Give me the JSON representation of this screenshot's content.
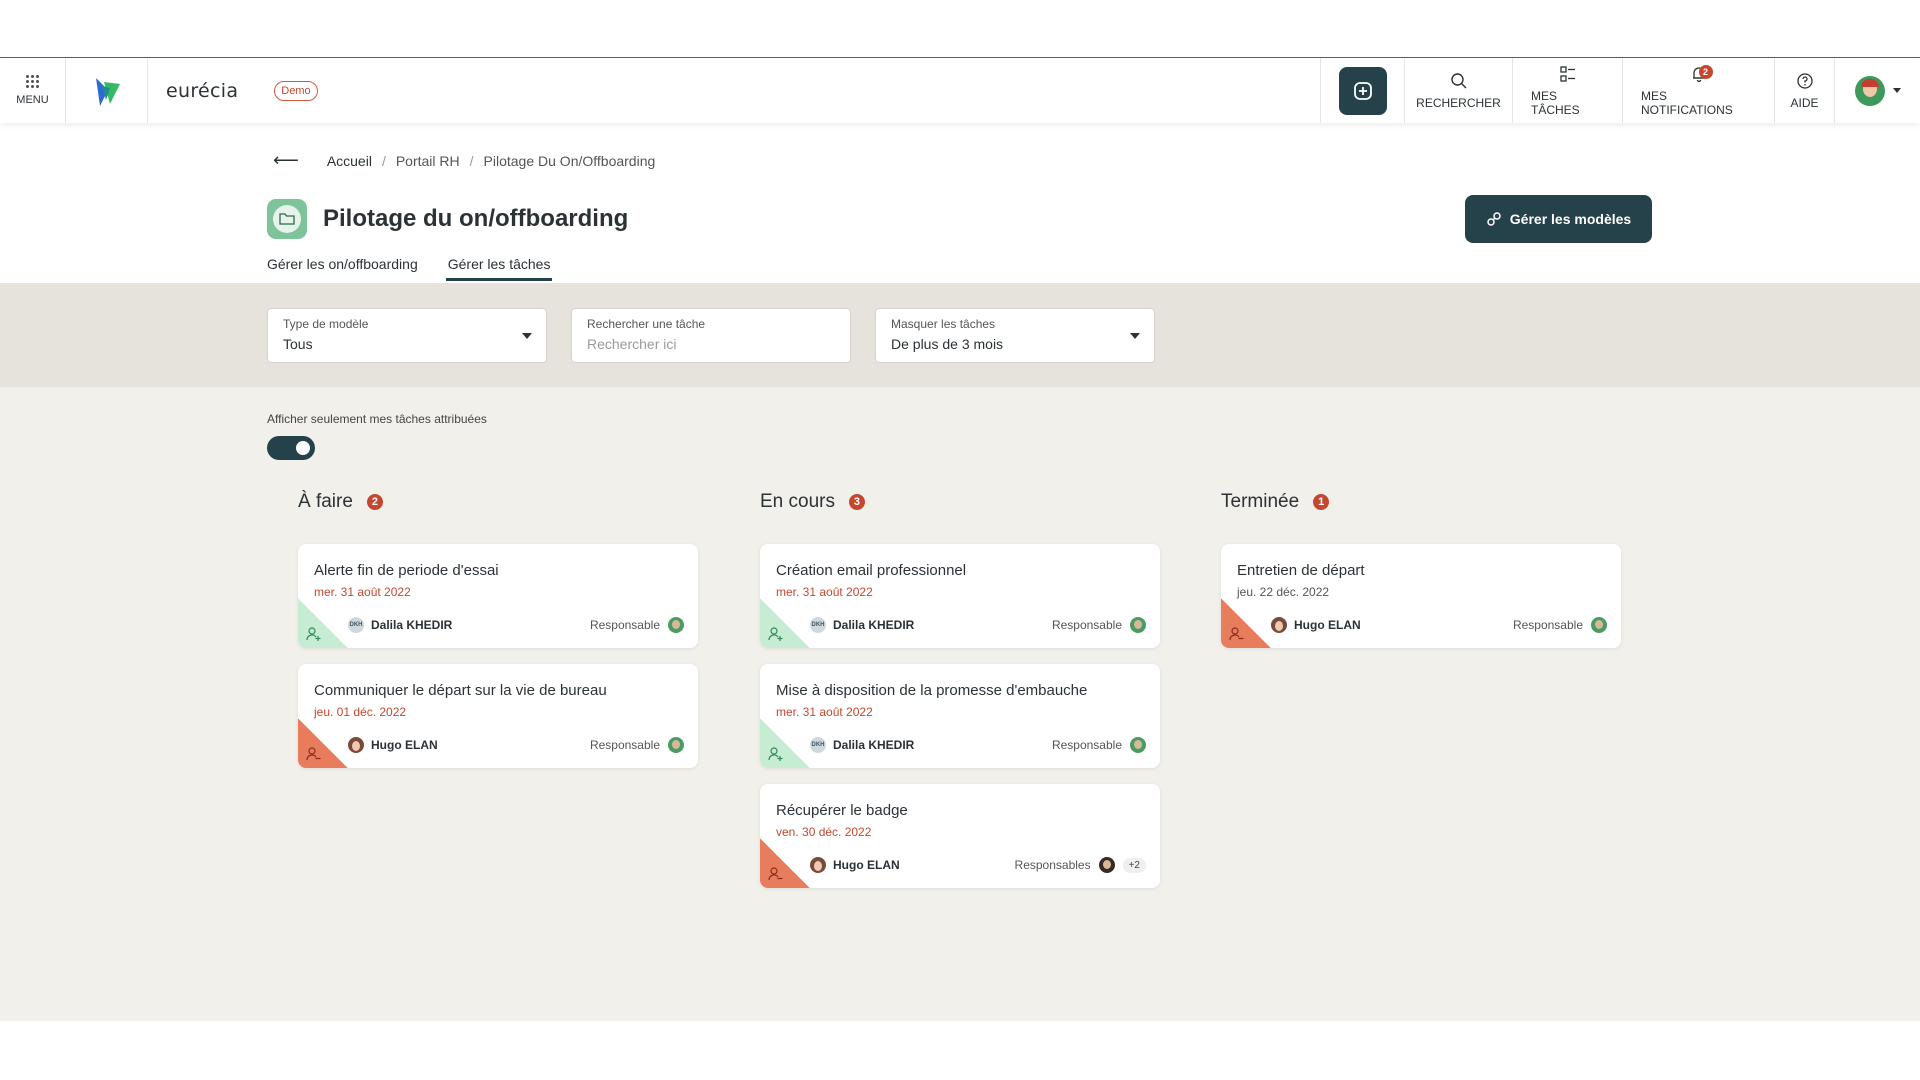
{
  "topbar": {
    "menu_label": "MENU",
    "brand_name": "eurécia",
    "demo_badge": "Demo",
    "search_label": "RECHERCHER",
    "tasks_label": "MES TÂCHES",
    "notifications_label": "MES NOTIFICATIONS",
    "notifications_count": "2",
    "help_label": "AIDE"
  },
  "breadcrumb": {
    "items": [
      "Accueil",
      "Portail RH",
      "Pilotage Du On/Offboarding"
    ]
  },
  "page": {
    "title": "Pilotage du on/offboarding",
    "manage_button": "Gérer les modèles",
    "tabs": [
      "Gérer les on/offboarding",
      "Gérer les tâches"
    ],
    "active_tab": "Gérer les tâches"
  },
  "filters": {
    "model_type": {
      "label": "Type de modèle",
      "value": "Tous"
    },
    "search_task": {
      "label": "Rechercher une tâche",
      "placeholder": "Rechercher ici"
    },
    "hide_tasks": {
      "label": "Masquer les tâches",
      "value": "De plus de 3 mois"
    }
  },
  "toggle": {
    "label": "Afficher seulement mes tâches attribuées",
    "on": true
  },
  "columns": [
    {
      "title": "À faire",
      "count": "2",
      "cards": [
        {
          "title": "Alerte fin de periode d'essai",
          "date": "mer. 31 août 2022",
          "person": "Dalila KHEDIR",
          "initials": "DKH",
          "responsible": "Responsable",
          "type": "onboarding"
        },
        {
          "title": "Communiquer le départ sur la vie de bureau",
          "date": "jeu. 01 déc. 2022",
          "person": "Hugo ELAN",
          "responsible": "Responsable",
          "type": "offboarding"
        }
      ]
    },
    {
      "title": "En cours",
      "count": "3",
      "cards": [
        {
          "title": "Création email professionnel",
          "date": "mer. 31 août 2022",
          "person": "Dalila KHEDIR",
          "initials": "DKH",
          "responsible": "Responsable",
          "type": "onboarding"
        },
        {
          "title": "Mise à disposition de la promesse d'embauche",
          "date": "mer. 31 août 2022",
          "person": "Dalila KHEDIR",
          "initials": "DKH",
          "responsible": "Responsable",
          "type": "onboarding"
        },
        {
          "title": "Récupérer le badge",
          "date": "ven. 30 déc. 2022",
          "person": "Hugo ELAN",
          "responsible": "Responsables",
          "extra": "+2",
          "type": "offboarding"
        }
      ]
    },
    {
      "title": "Terminée",
      "count": "1",
      "cards": [
        {
          "title": "Entretien de départ",
          "date": "jeu. 22 déc. 2022",
          "person": "Hugo ELAN",
          "responsible": "Responsable",
          "type": "offboarding"
        }
      ]
    }
  ],
  "colors": {
    "accent": "#25414a",
    "badge": "#c4482f",
    "onboarding": "#c6ecd3",
    "offboarding": "#e87d5e",
    "filters_bg": "#e6e3dc",
    "board_bg": "#f2f0eb"
  }
}
